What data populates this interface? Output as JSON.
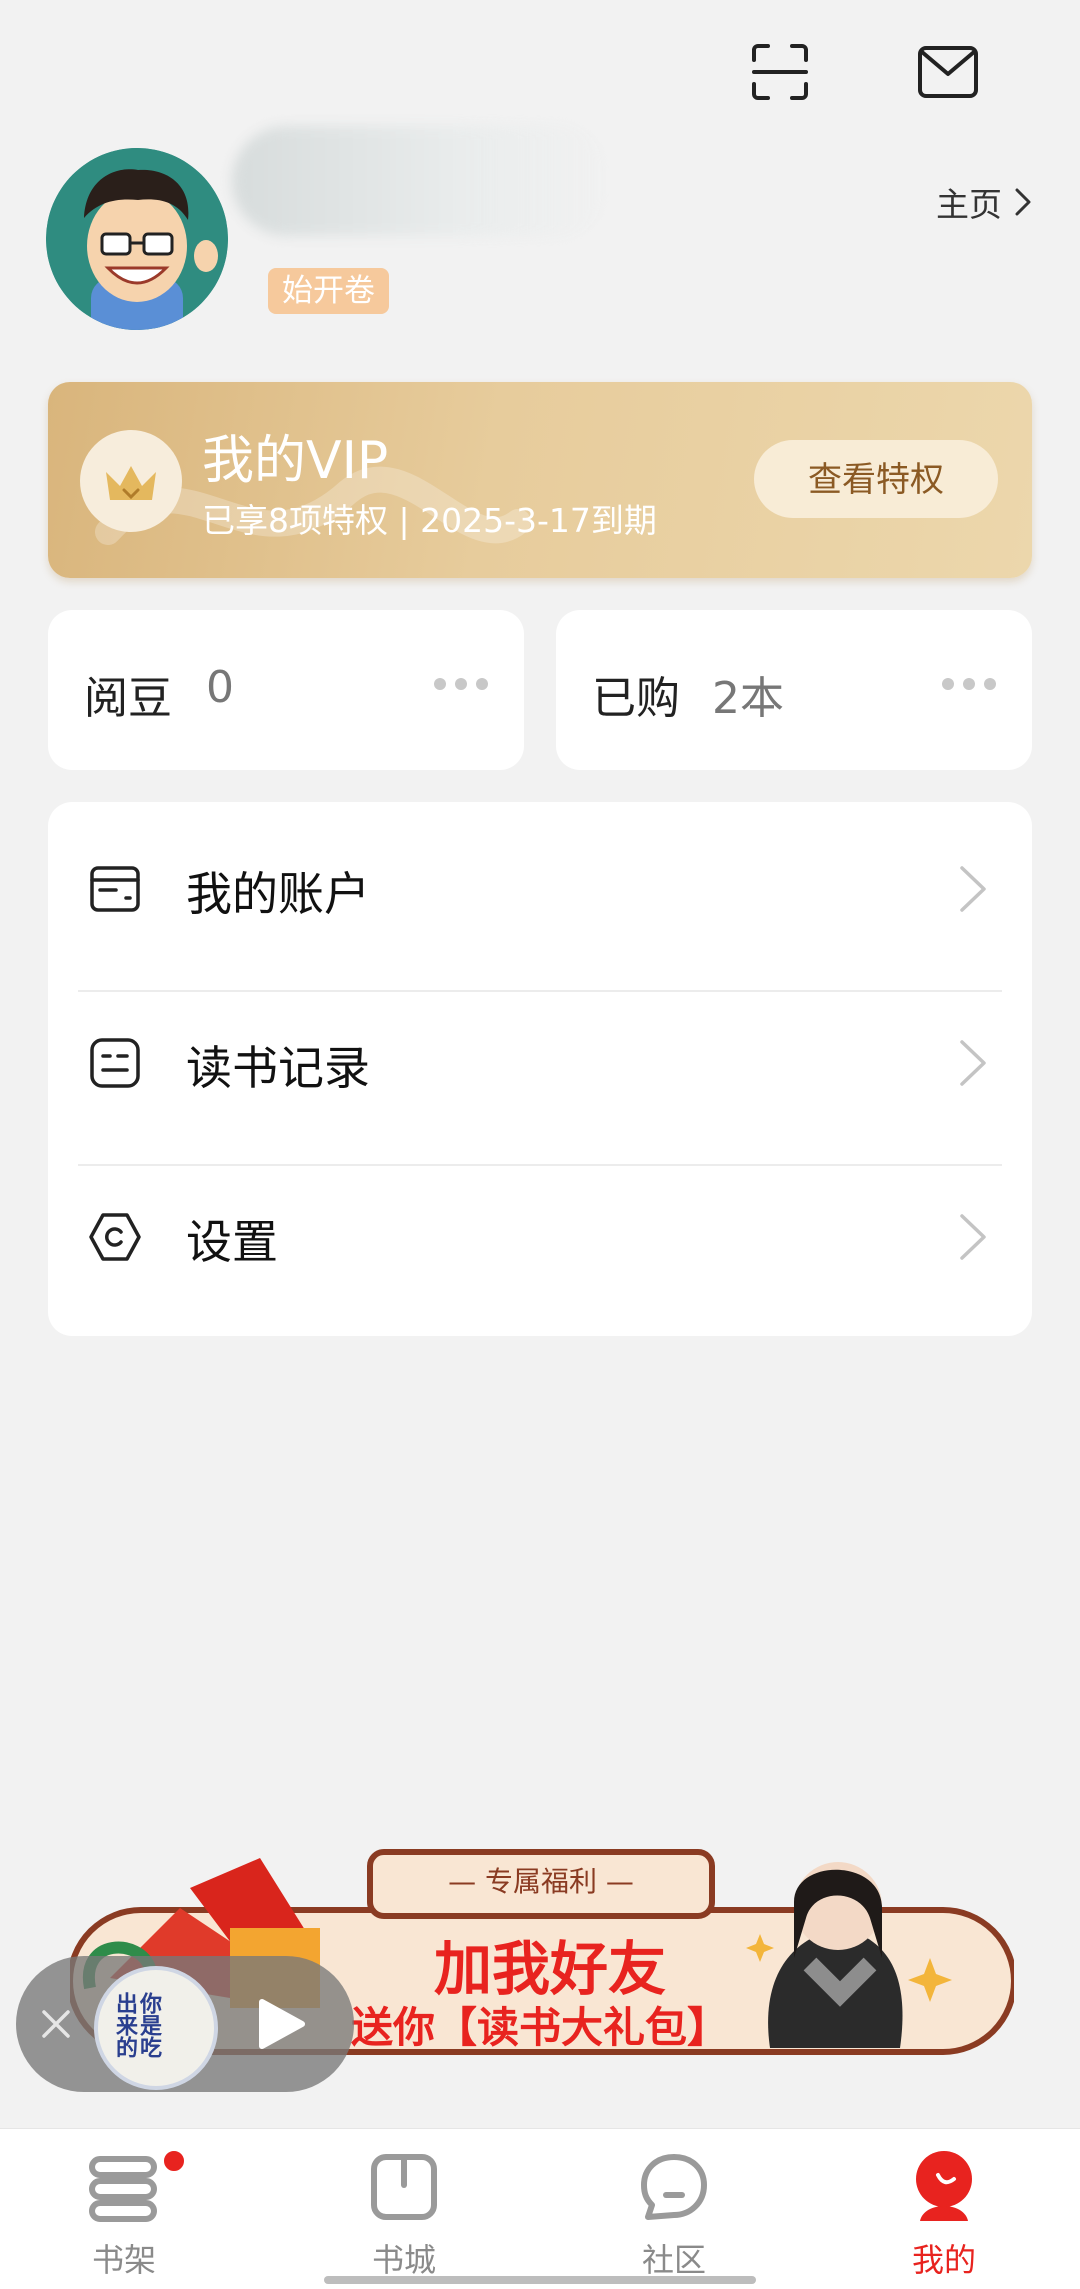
{
  "header": {
    "scan_icon": "scan-icon",
    "mail_icon": "mail-icon"
  },
  "profile": {
    "badge": "始开卷",
    "homepage_link": "主页"
  },
  "vip": {
    "title": "我的VIP",
    "subtitle": "已享8项特权 | 2025-3-17到期",
    "button": "查看特权",
    "accent": "#d9b57c"
  },
  "stats": [
    {
      "label": "阅豆",
      "value": "0"
    },
    {
      "label": "已购",
      "value": "2本"
    }
  ],
  "menu": [
    {
      "label": "我的账户",
      "icon": "wallet-icon"
    },
    {
      "label": "读书记录",
      "icon": "record-icon"
    },
    {
      "label": "设置",
      "icon": "settings-icon"
    }
  ],
  "banner": {
    "tag": "— 专属福利 —",
    "line1": "加我好友",
    "line2": "送你【读书大礼包】"
  },
  "player": {
    "cover_text": "你是吃出来的"
  },
  "tabs": [
    {
      "label": "书架",
      "icon": "bookshelf-icon",
      "has_dot": true
    },
    {
      "label": "书城",
      "icon": "bookstore-icon"
    },
    {
      "label": "社区",
      "icon": "community-icon"
    },
    {
      "label": "我的",
      "icon": "profile-icon",
      "active": true
    }
  ],
  "colors": {
    "brand_red": "#e8231f",
    "vip_gold": "#d9b57c"
  }
}
